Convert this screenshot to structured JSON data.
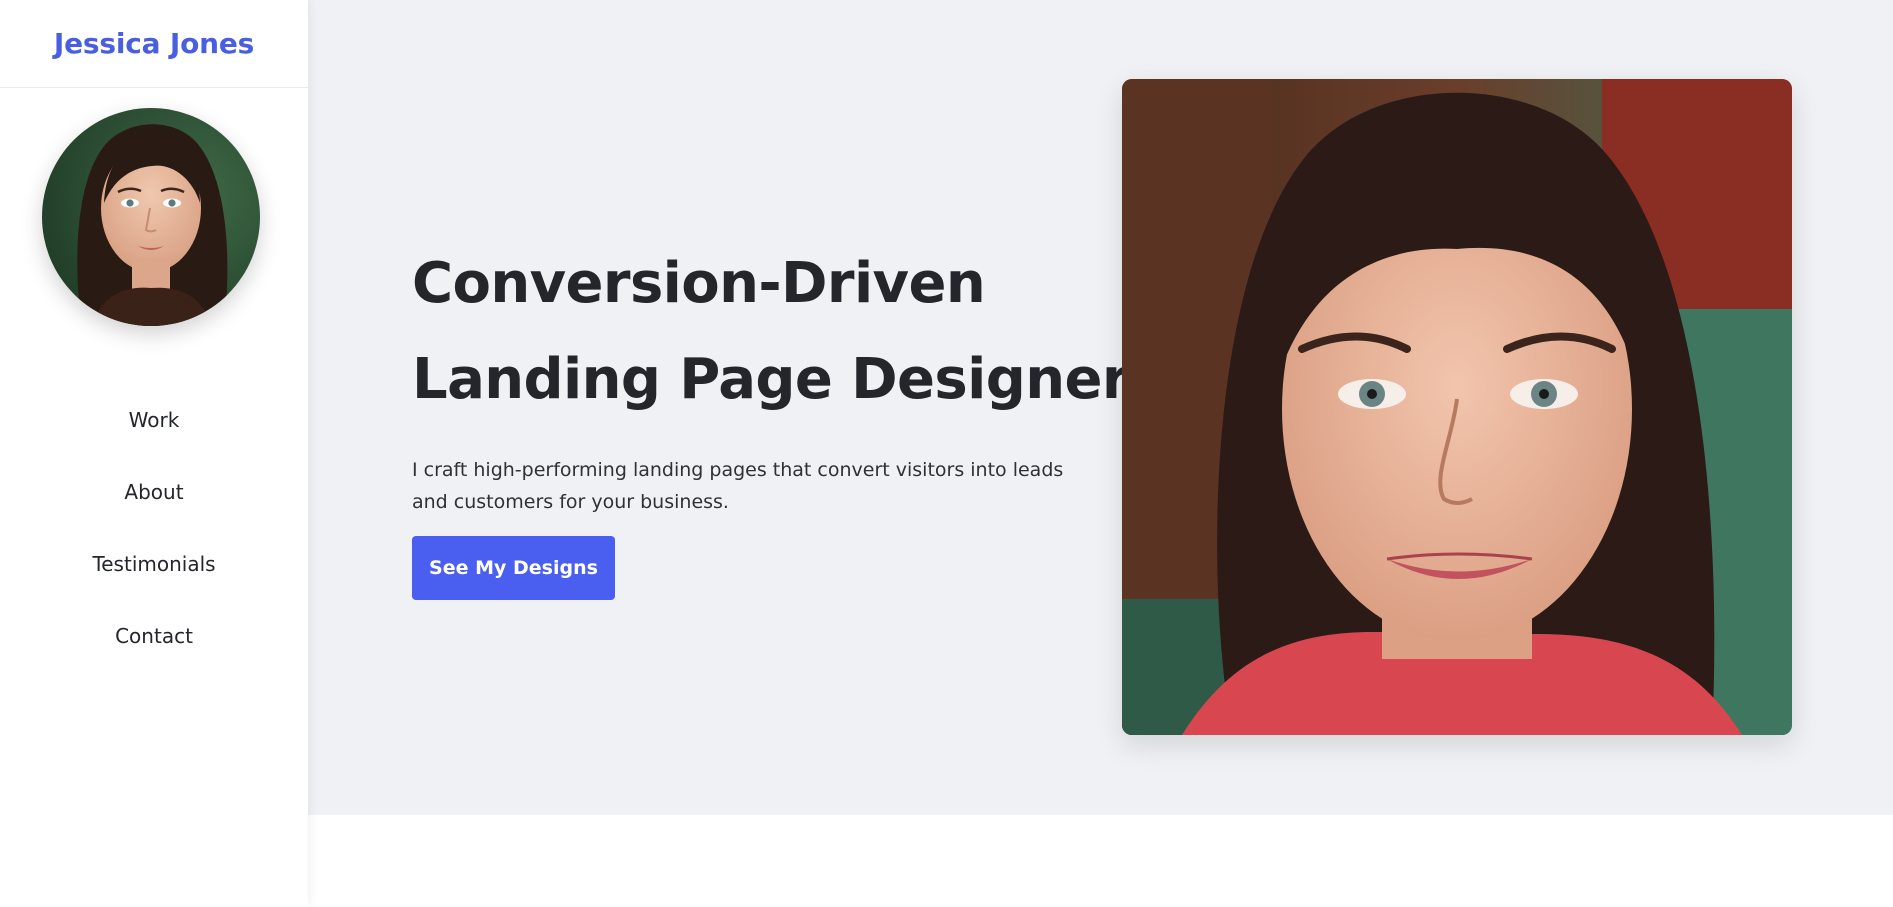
{
  "sidebar": {
    "brand": "Jessica Jones",
    "avatar_icon": "avatar-portrait",
    "nav": [
      {
        "label": "Work"
      },
      {
        "label": "About"
      },
      {
        "label": "Testimonials"
      },
      {
        "label": "Contact"
      }
    ]
  },
  "hero": {
    "title_line1": "Conversion-Driven",
    "title_line2": "Landing Page Designer",
    "subtitle": "I craft high-performing landing pages that convert visitors into leads and customers for your business.",
    "cta_label": "See My Designs",
    "portrait_icon": "hero-portrait"
  },
  "colors": {
    "accent": "#4a5ff0",
    "brand_text": "#4a5fe0",
    "hero_bg": "#f0f1f5",
    "text": "#24262b"
  }
}
